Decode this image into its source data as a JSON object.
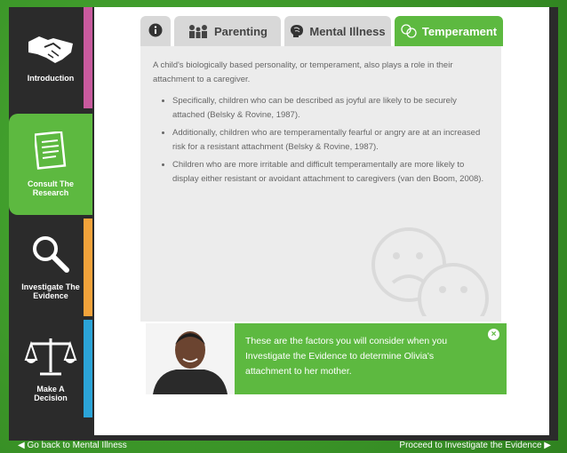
{
  "sidebar": {
    "items": [
      {
        "label": "Introduction",
        "strip_color": "#c95a9e",
        "icon": "handshake-icon"
      },
      {
        "label": "Consult The Research",
        "strip_color": "#5db940",
        "icon": "document-icon"
      },
      {
        "label": "Investigate The Evidence",
        "strip_color": "#f2a33a",
        "icon": "magnifier-icon"
      },
      {
        "label": "Make A Decision",
        "strip_color": "#2ba4d8",
        "icon": "scales-icon"
      }
    ]
  },
  "tabs": [
    {
      "label": "",
      "icon": "info-icon"
    },
    {
      "label": "Parenting",
      "icon": "family-icon"
    },
    {
      "label": "Mental Illness",
      "icon": "brain-icon"
    },
    {
      "label": "Temperament",
      "icon": "faces-icon"
    }
  ],
  "content": {
    "intro": "A child's biologically based personality, or temperament, also plays a role in their attachment to a caregiver.",
    "bullets": [
      "Specifically, children who can be described as joyful are likely to be securely attached (Belsky & Rovine, 1987).",
      "Additionally, children who are temperamentally fearful or angry are at an increased risk for a resistant attachment (Belsky & Rovine, 1987).",
      "Children who are more irritable and difficult temperamentally are more likely to display either resistant or avoidant attachment to caregivers (van den Boom, 2008)."
    ]
  },
  "callout": {
    "text": "These are the factors you will consider when you Investigate the Evidence to determine Olivia's attachment to her mother.",
    "close": "×"
  },
  "footer": {
    "back": "Go back to Mental Illness",
    "forward": "Proceed to Investigate the Evidence"
  },
  "colors": {
    "accent": "#5db940",
    "tab_inactive": "#d8d8d8"
  }
}
